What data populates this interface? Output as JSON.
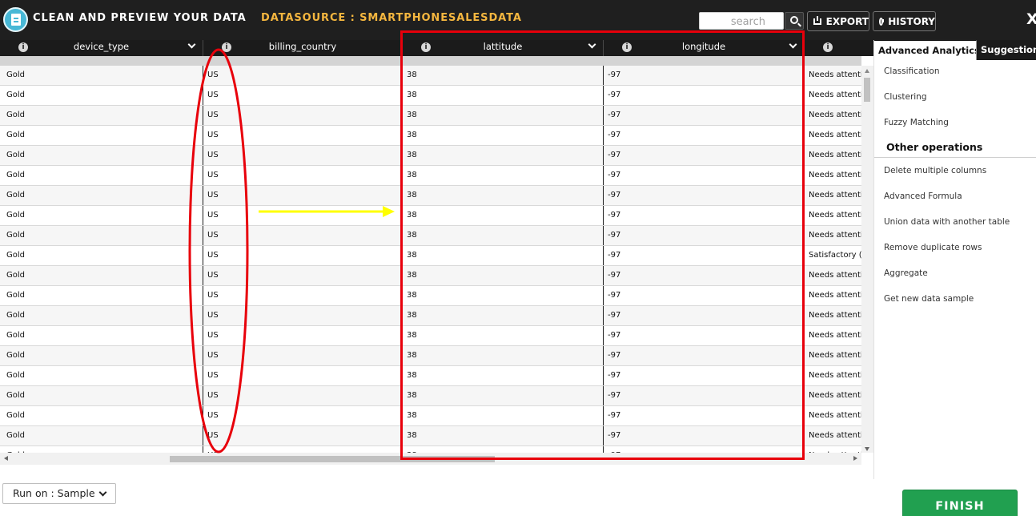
{
  "header": {
    "title": "CLEAN AND PREVIEW YOUR DATA",
    "datasource": "DATASOURCE : SMARTPHONESALESDATA",
    "search_placeholder": "search",
    "export_label": "EXPORT",
    "history_label": "HISTORY",
    "close_label": "X"
  },
  "columns": [
    {
      "name": "device_type",
      "info": "i"
    },
    {
      "name": "billing_country",
      "info": "i"
    },
    {
      "name": "lattitude",
      "info": "i"
    },
    {
      "name": "longitude",
      "info": "i"
    },
    {
      "name": "",
      "info": "i"
    }
  ],
  "rows": [
    [
      "Gold",
      "US",
      "38",
      "-97",
      "Needs attention"
    ],
    [
      "Gold",
      "US",
      "38",
      "-97",
      "Needs attention"
    ],
    [
      "Gold",
      "US",
      "38",
      "-97",
      "Needs attention"
    ],
    [
      "Gold",
      "US",
      "38",
      "-97",
      "Needs attention"
    ],
    [
      "Gold",
      "US",
      "38",
      "-97",
      "Needs attention"
    ],
    [
      "Gold",
      "US",
      "38",
      "-97",
      "Needs attention"
    ],
    [
      "Gold",
      "US",
      "38",
      "-97",
      "Needs attention"
    ],
    [
      "Gold",
      "US",
      "38",
      "-97",
      "Needs attention"
    ],
    [
      "Gold",
      "US",
      "38",
      "-97",
      "Needs attention"
    ],
    [
      "Gold",
      "US",
      "38",
      "-97",
      "Satisfactory (>"
    ],
    [
      "Gold",
      "US",
      "38",
      "-97",
      "Needs attention"
    ],
    [
      "Gold",
      "US",
      "38",
      "-97",
      "Needs attention"
    ],
    [
      "Gold",
      "US",
      "38",
      "-97",
      "Needs attention"
    ],
    [
      "Gold",
      "US",
      "38",
      "-97",
      "Needs attention"
    ],
    [
      "Gold",
      "US",
      "38",
      "-97",
      "Needs attention"
    ],
    [
      "Gold",
      "US",
      "38",
      "-97",
      "Needs attention"
    ],
    [
      "Gold",
      "US",
      "38",
      "-97",
      "Needs attention"
    ],
    [
      "Gold",
      "US",
      "38",
      "-97",
      "Needs attention"
    ],
    [
      "Gold",
      "US",
      "38",
      "-97",
      "Needs attention"
    ],
    [
      "Gold",
      "US",
      "38",
      "-97",
      "Needs attention"
    ]
  ],
  "right_panel": {
    "tabs": [
      "Advanced Analytics",
      "Suggestions"
    ],
    "analytics": [
      "Classification",
      "Clustering",
      "Fuzzy Matching"
    ],
    "section_title": "Other operations",
    "operations": [
      "Delete multiple columns",
      "Advanced Formula",
      "Union data with another table",
      "Remove duplicate rows",
      "Aggregate",
      "Get new data sample"
    ]
  },
  "footer": {
    "run_on_label": "Run on : Sample",
    "finish_label": "FINISH"
  },
  "colors": {
    "topbar": "#1f1f1f",
    "datasource": "#f4b63f",
    "finish": "#21a050",
    "annotation_red": "#e8000b",
    "annotation_arrow": "#ffff00"
  }
}
